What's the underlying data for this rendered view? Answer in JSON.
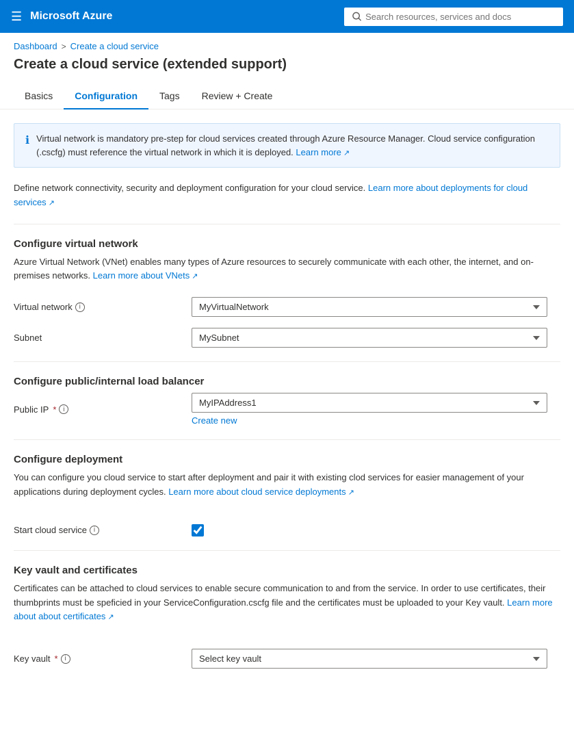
{
  "nav": {
    "hamburger_icon": "☰",
    "logo": "Microsoft Azure",
    "search_placeholder": "Search resources, services and docs"
  },
  "breadcrumb": {
    "home": "Dashboard",
    "separator": ">",
    "current": "Create a cloud service"
  },
  "page": {
    "title": "Create a cloud service (extended support)"
  },
  "tabs": [
    {
      "id": "basics",
      "label": "Basics",
      "active": false
    },
    {
      "id": "configuration",
      "label": "Configuration",
      "active": true
    },
    {
      "id": "tags",
      "label": "Tags",
      "active": false
    },
    {
      "id": "review-create",
      "label": "Review + Create",
      "active": false
    }
  ],
  "info_banner": {
    "text": "Virtual network is mandatory pre-step for cloud services created through Azure Resource Manager. Cloud service configuration (.cscfg) must reference the virtual network in which it is deployed.",
    "learn_more_label": "Learn more",
    "learn_more_icon": "↗"
  },
  "description": {
    "text": "Define network connectivity, security and deployment configuration for your cloud service.",
    "link_label": "Learn more about deployments for cloud services",
    "link_icon": "↗"
  },
  "virtual_network_section": {
    "heading": "Configure virtual network",
    "description": "Azure Virtual Network (VNet) enables many types of Azure resources to securely communicate with each other, the internet, and on-premises networks.",
    "learn_more_label": "Learn more about VNets",
    "learn_more_icon": "↗",
    "virtual_network_label": "Virtual network",
    "virtual_network_value": "MyVirtualNetwork",
    "subnet_label": "Subnet",
    "subnet_value": "MySubnet"
  },
  "load_balancer_section": {
    "heading": "Configure public/internal load balancer",
    "public_ip_label": "Public IP",
    "public_ip_value": "MyIPAddress1",
    "create_new_label": "Create new"
  },
  "deployment_section": {
    "heading": "Configure deployment",
    "description": "You can configure you cloud service to start after deployment and pair it with existing clod services for easier management of your applications during deployment cycles.",
    "link_label": "Learn more about cloud service deployments",
    "link_icon": "↗",
    "start_cloud_service_label": "Start cloud service",
    "start_cloud_service_checked": true
  },
  "key_vault_section": {
    "heading": "Key vault and certificates",
    "description": "Certificates can be attached to cloud services to enable secure communication to and from the service. In order to use certificates, their thumbprints must be speficied in your ServiceConfiguration.cscfg file and the certificates must be uploaded to your Key vault.",
    "learn_more_label": "Learn more about about certificates",
    "learn_more_icon": "↗",
    "key_vault_label": "Key vault",
    "key_vault_placeholder": "Select key vault"
  }
}
